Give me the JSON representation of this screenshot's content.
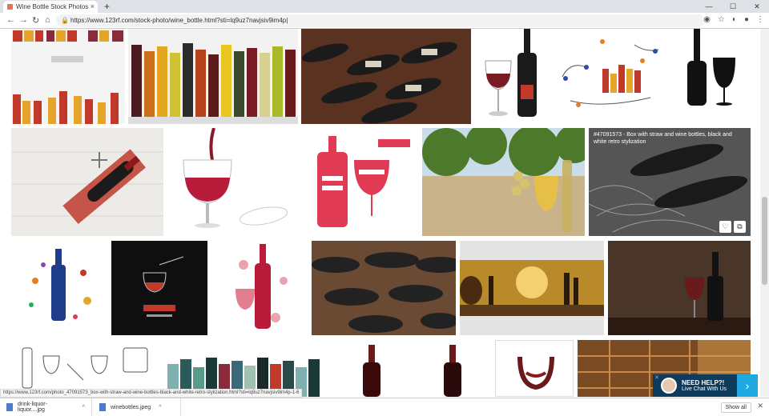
{
  "browser": {
    "tab_title": "Wine Bottle Stock Photos And Im",
    "tab_close": "×",
    "new_tab": "+",
    "url": "https://www.123rf.com/stock-photo/wine_bottle.html?sti=lq9uz7navjsiv9im4p|",
    "window_controls": [
      "—",
      "☐",
      "✕"
    ]
  },
  "tile_overlay": {
    "title": "#47091573 - Box with straw and wine bottles, black and white retro stylization",
    "actions": [
      "♡",
      "⧉"
    ]
  },
  "status_url": "https://www.123rf.com/photo_47091573_box-with-straw-and-wine-bottles-black-and-white-retro-stylization.html?sti=lq9uz7navjsiv9im4p-1-6",
  "help_chat": {
    "title": "NEED HELP?!",
    "subtitle": "Live Chat With Us",
    "go": "›",
    "close": "✕"
  },
  "downloads": {
    "items": [
      {
        "name": "drink-liquor-liquor....jpg"
      },
      {
        "name": "winebottles.jpeg"
      }
    ],
    "show_all": "Show all",
    "close": "✕"
  }
}
